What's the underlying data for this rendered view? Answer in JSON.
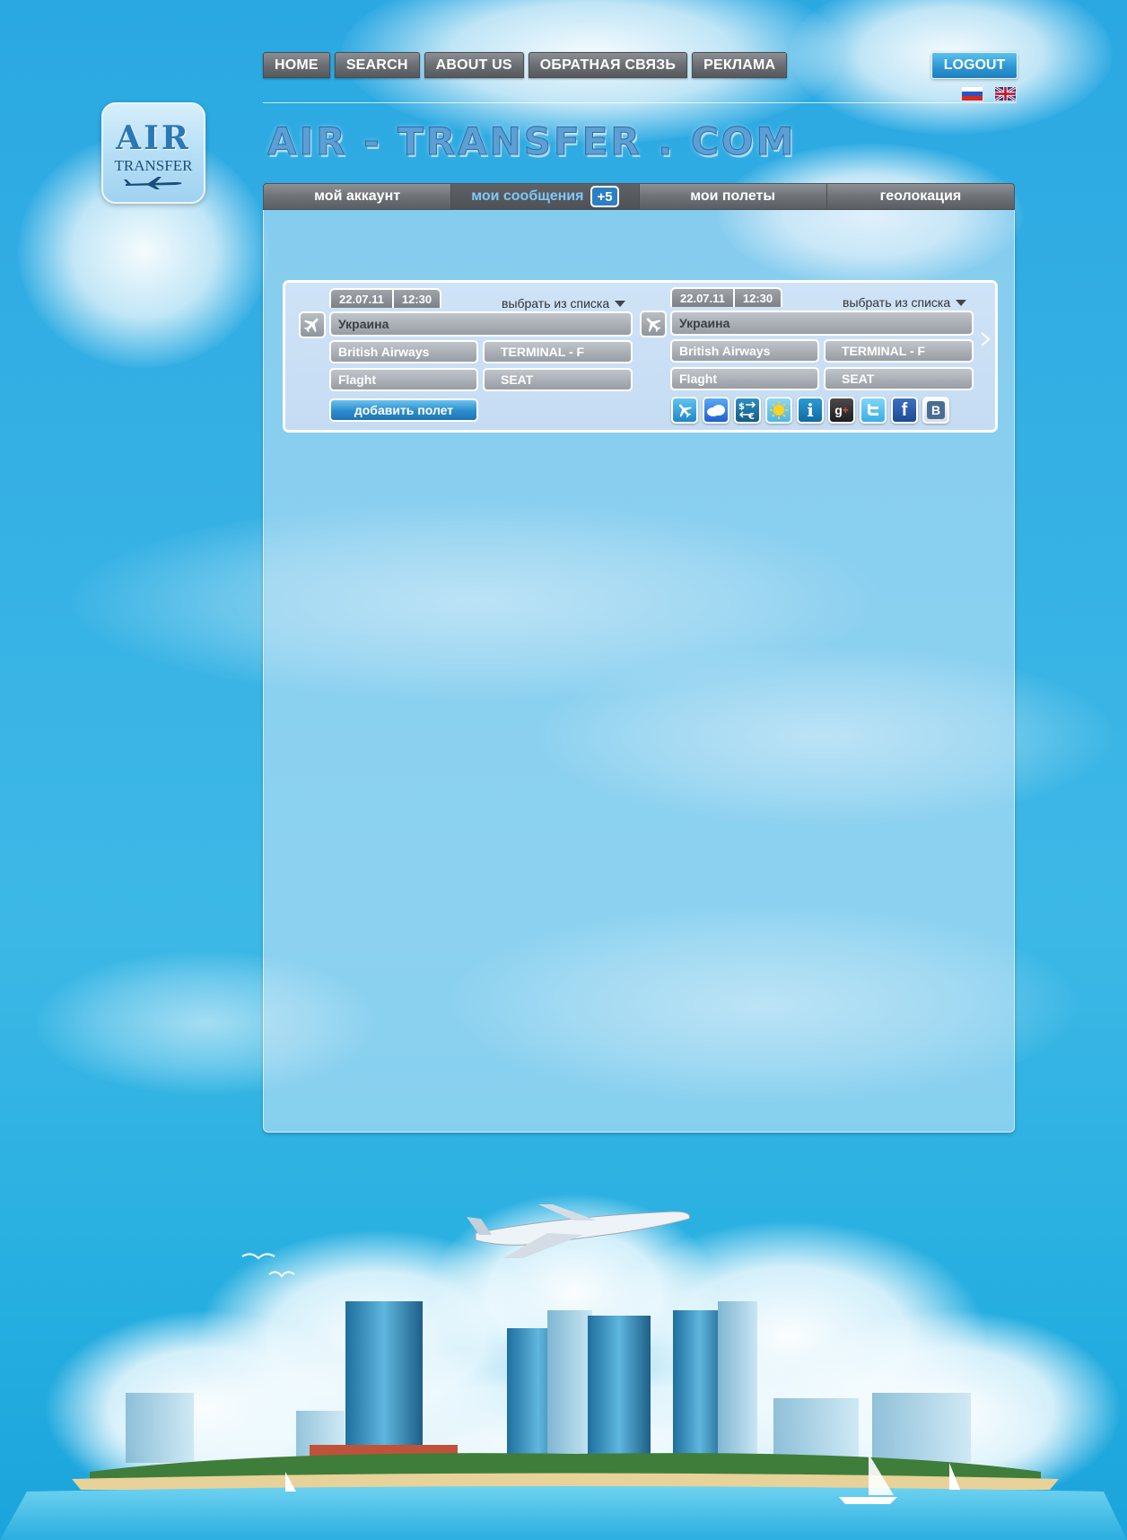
{
  "top_nav": {
    "items": [
      {
        "label": "HOME"
      },
      {
        "label": "SEARCH"
      },
      {
        "label": "ABOUT US"
      },
      {
        "label": "ОБРАТНАЯ СВЯЗЬ"
      },
      {
        "label": "РЕКЛАМА"
      }
    ],
    "logout_label": "LOGOUT"
  },
  "languages": [
    "ru-flag-icon",
    "uk-flag-icon"
  ],
  "logo": {
    "line1": "AIR",
    "line2": "TRANSFER"
  },
  "site_title": "AIR - TRANSFER . COM",
  "tabs": {
    "account": "мой аккаунт",
    "messages": "мои сообщения",
    "messages_badge": "+5",
    "flights": "мои полеты",
    "geolocation": "геолокация"
  },
  "flights": [
    {
      "date": "22.07.11",
      "time": "12:30",
      "choose_label": "выбрать из списка",
      "country": "Украина",
      "airline": "British Airways",
      "terminal": "TERMINAL - F",
      "flight": "Flaght",
      "seat": "SEAT",
      "add_label": "добавить полет"
    },
    {
      "date": "22.07.11",
      "time": "12:30",
      "choose_label": "выбрать из списка",
      "country": "Украина",
      "airline": "British Airways",
      "terminal": "TERMINAL - F",
      "flight": "Flaght",
      "seat": "SEAT"
    }
  ],
  "service_icons": [
    "plane-service-icon",
    "weather-cloud-icon",
    "currency-exchange-icon",
    "sun-icon",
    "info-icon",
    "google-plus-icon",
    "twitter-icon",
    "facebook-icon",
    "vkontakte-icon"
  ],
  "colors": {
    "sky": "#2aa8e2",
    "tab_active_text": "#7fc8f6",
    "button_blue": "#2c8ccb",
    "nav_gray": "#6e7276"
  }
}
